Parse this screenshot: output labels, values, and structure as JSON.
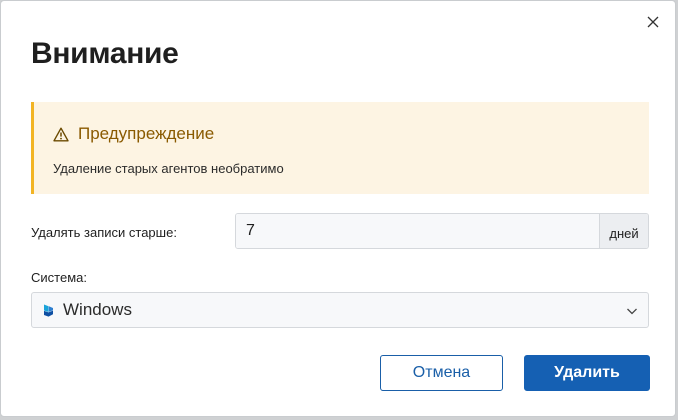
{
  "dialog": {
    "title": "Внимание",
    "close_icon": "close-icon"
  },
  "warning": {
    "icon": "warning-icon",
    "title": "Предупреждение",
    "text": "Удаление старых агентов необратимо",
    "accent_color": "#f2b424"
  },
  "retention": {
    "label": "Удалять записи старше:",
    "value": "7",
    "unit": "дней"
  },
  "system": {
    "label": "Система:",
    "selected": "Windows",
    "icon": "windows-icon",
    "chevron_icon": "chevron-down-icon"
  },
  "actions": {
    "cancel_label": "Отмена",
    "delete_label": "Удалить",
    "primary_color": "#1560b3"
  }
}
